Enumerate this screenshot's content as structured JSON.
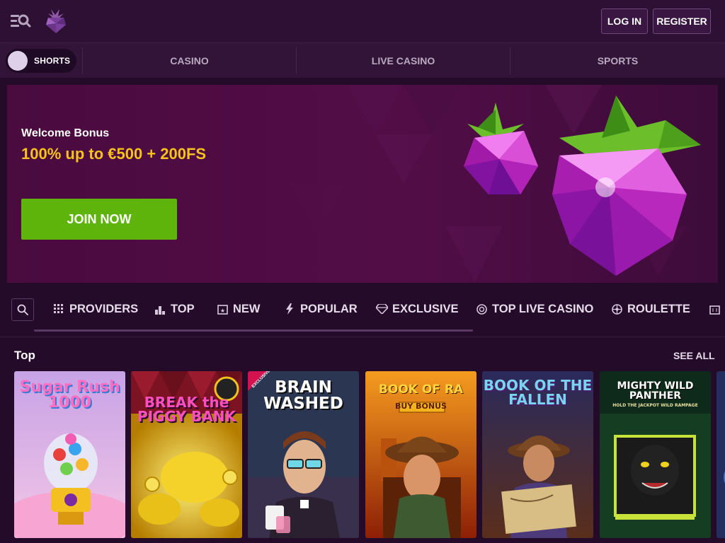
{
  "header": {
    "login_label": "LOG IN",
    "register_label": "REGISTER"
  },
  "catnav": {
    "shorts_label": "SHORTS",
    "tabs": [
      {
        "label": "CASINO"
      },
      {
        "label": "LIVE CASINO"
      },
      {
        "label": "SPORTS"
      }
    ]
  },
  "banner": {
    "title": "Welcome Bonus",
    "offer": "100% up to €500 + 200FS",
    "cta_label": "JOIN NOW"
  },
  "filters": [
    {
      "label": "PROVIDERS",
      "icon": "grid-icon"
    },
    {
      "label": "TOP",
      "icon": "podium-icon"
    },
    {
      "label": "NEW",
      "icon": "new-icon"
    },
    {
      "label": "POPULAR",
      "icon": "lightning-icon"
    },
    {
      "label": "EXCLUSIVE",
      "icon": "diamond-icon"
    },
    {
      "label": "TOP LIVE CASINO",
      "icon": "chip-icon"
    },
    {
      "label": "ROULETTE",
      "icon": "roulette-icon"
    }
  ],
  "section": {
    "title": "Top",
    "see_all_label": "SEE ALL"
  },
  "games": [
    {
      "art_title": "Sugar Rush 1000"
    },
    {
      "art_title": "BREAK the PIGGY BANK"
    },
    {
      "art_title": "BRAIN WASHED",
      "badge": "EXCLUSIVE"
    },
    {
      "art_title": "BOOK OF RA",
      "subtitle": "BUY BONUS"
    },
    {
      "art_title": "BOOK OF THE FALLEN"
    },
    {
      "art_title": "MIGHTY WILD PANTHER",
      "subtitle": "HOLD THE JACKPOT WILD RAMPAGE"
    }
  ],
  "colors": {
    "background": "#240b2a",
    "header": "#2e1034",
    "accent_yellow": "#f6c21c",
    "cta_green": "#5fb40c"
  }
}
